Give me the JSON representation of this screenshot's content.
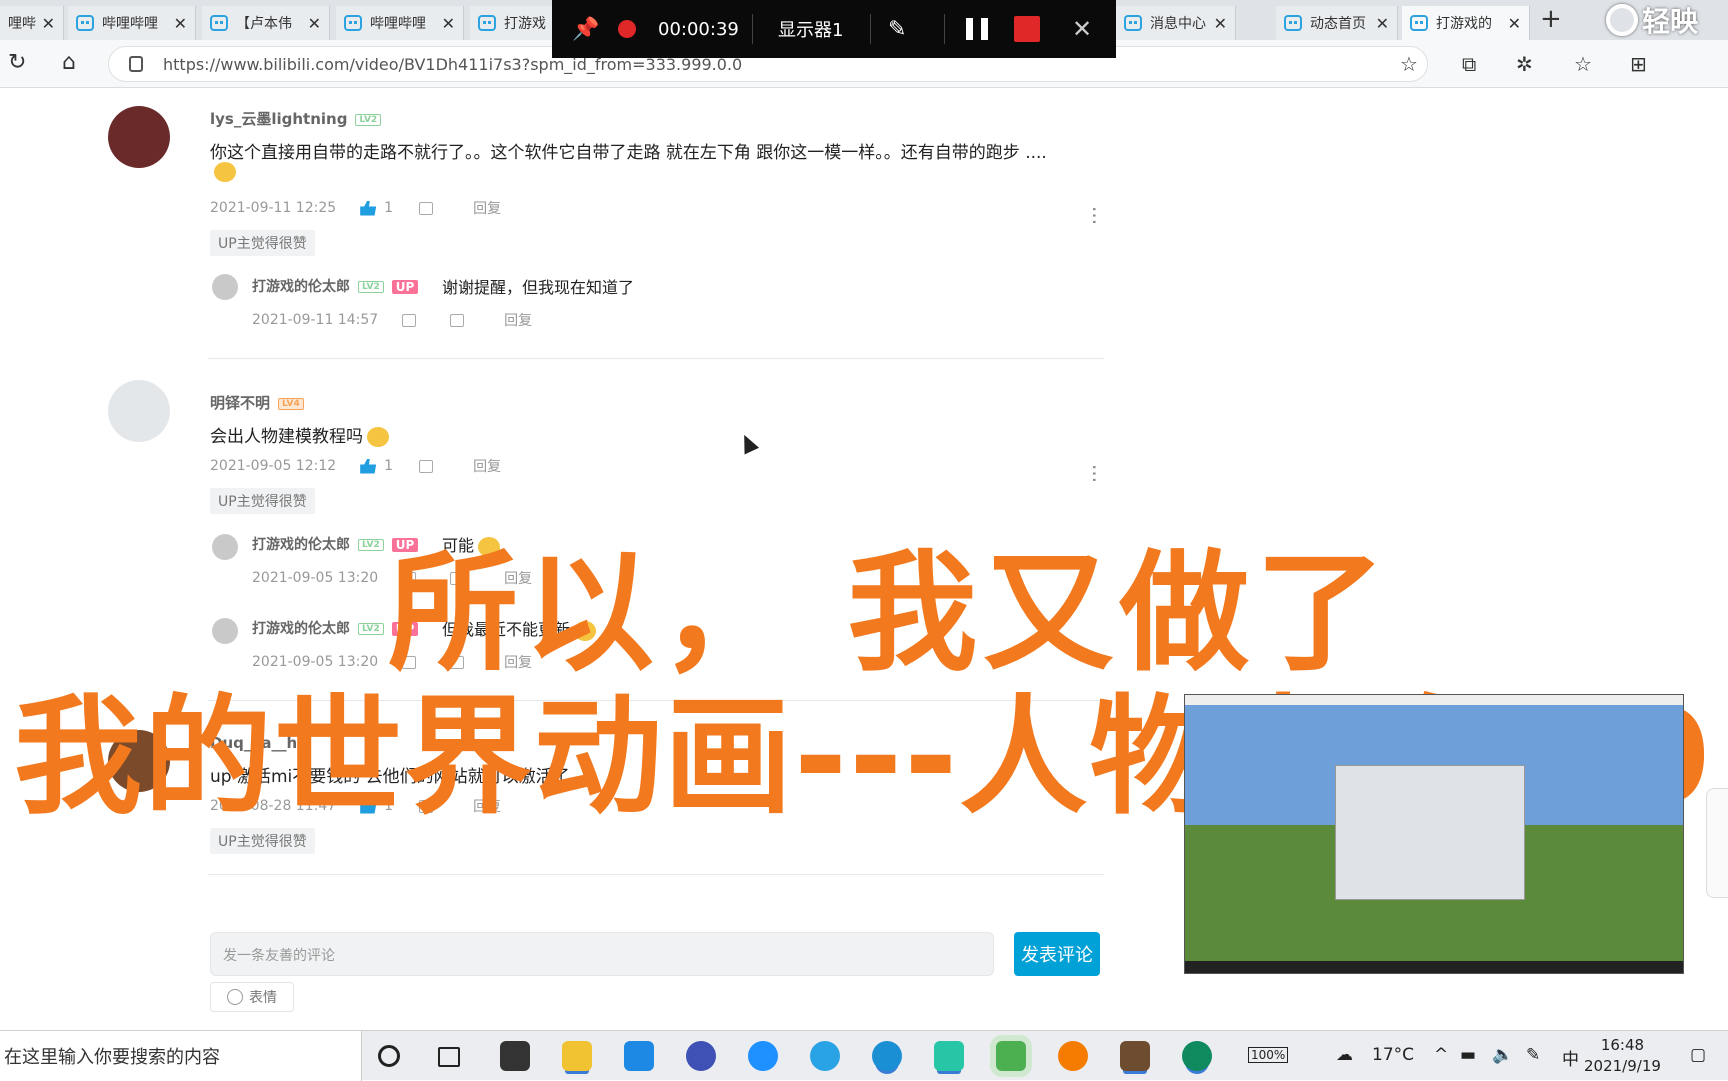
{
  "tabs": [
    {
      "label": "哩哔哩"
    },
    {
      "label": "哔哩哔哩"
    },
    {
      "label": "【卢本伟"
    },
    {
      "label": "哔哩哔哩"
    },
    {
      "label": "打游戏"
    },
    {
      "label": "消息中心"
    },
    {
      "label": "动态首页"
    },
    {
      "label": "打游戏的"
    }
  ],
  "watermark": "轻映",
  "address": {
    "url": "https://www.bilibili.com/video/BV1Dh411i7s3?spm_id_from=333.999.0.0"
  },
  "recorder": {
    "time": "00:00:39",
    "display": "显示器1"
  },
  "comments": [
    {
      "user": "lys_云墨lightning",
      "level": "LV2",
      "text": "你这个直接用自带的走路不就行了。。这个软件它自带了走路 就在左下角 跟你这一模一样。。还有自带的跑步 ....",
      "time": "2021-09-11 12:25",
      "likes": "1",
      "reply": "回复",
      "badge": "UP主觉得很赞",
      "replies": [
        {
          "user": "打游戏的伦太郎",
          "level": "LV2",
          "tag": "UP",
          "text": "谢谢提醒，但我现在知道了",
          "time": "2021-09-11 14:57",
          "reply": "回复"
        }
      ]
    },
    {
      "user": "明铎不明",
      "level": "LV4",
      "text": "会出人物建模教程吗",
      "time": "2021-09-05 12:12",
      "likes": "1",
      "reply": "回复",
      "badge": "UP主觉得很赞",
      "replies": [
        {
          "user": "打游戏的伦太郎",
          "level": "LV2",
          "tag": "UP",
          "text": "可能",
          "time": "2021-09-05 13:20",
          "reply": "回复"
        },
        {
          "user": "打游戏的伦太郎",
          "level": "LV2",
          "tag": "UP",
          "text": "但我最近不能更新",
          "time": "2021-09-05 13:20",
          "reply": "回复"
        }
      ]
    },
    {
      "user": "Duq_ka__h",
      "text": "up 激活mi不要钱的 去他们的网站就可以激活了",
      "time": "2021-08-28 11:47",
      "likes": "1",
      "reply": "回复",
      "badge": "UP主觉得很赞"
    }
  ],
  "overlay": {
    "line1": "所以， 我又做了",
    "line2": "我的世界动画---人物走路2.0"
  },
  "composer": {
    "placeholder": "发一条友善的评论",
    "send": "发表评论",
    "emoji": "表情"
  },
  "taskbar": {
    "search": "在这里输入你要搜索的内容",
    "battery": "100%",
    "weather": "17°C",
    "ime": "中",
    "time": "16:48",
    "date": "2021/9/19"
  }
}
